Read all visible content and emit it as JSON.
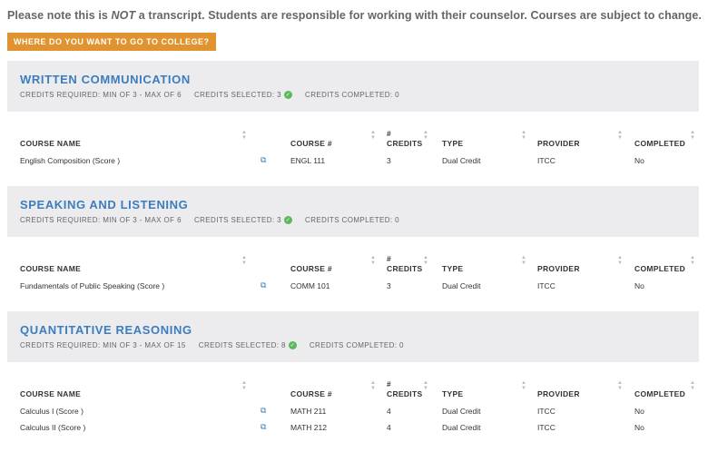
{
  "notice": {
    "prefix": "Please note this is ",
    "emphasis": "NOT",
    "suffix": " a transcript. Students are responsible for working with their counselor. Courses are subject to change."
  },
  "college_button": "WHERE DO YOU WANT TO GO TO COLLEGE?",
  "colors": {
    "accent": "#3c7dbd",
    "button": "#e0932f",
    "check": "#5cb85c",
    "header_bg": "#ececee"
  },
  "columns": {
    "course_name": "COURSE NAME",
    "course_num": "COURSE #",
    "credits_top": "#",
    "credits": "CREDITS",
    "type": "TYPE",
    "provider": "PROVIDER",
    "completed": "COMPLETED"
  },
  "row_icon": "copy-icon",
  "sections": [
    {
      "title": "WRITTEN COMMUNICATION",
      "required": "CREDITS REQUIRED: MIN OF 3 - MAX OF 6",
      "selected": "CREDITS SELECTED: 3",
      "completed": "CREDITS COMPLETED: 0",
      "rows": [
        {
          "name": "English Composition (Score )",
          "num": "ENGL 111",
          "credits": "3",
          "type": "Dual Credit",
          "provider": "ITCC",
          "completed": "No"
        }
      ]
    },
    {
      "title": "SPEAKING AND LISTENING",
      "required": "CREDITS REQUIRED: MIN OF 3 - MAX OF 6",
      "selected": "CREDITS SELECTED: 3",
      "completed": "CREDITS COMPLETED: 0",
      "rows": [
        {
          "name": "Fundamentals of Public Speaking (Score )",
          "num": "COMM 101",
          "credits": "3",
          "type": "Dual Credit",
          "provider": "ITCC",
          "completed": "No"
        }
      ]
    },
    {
      "title": "QUANTITATIVE REASONING",
      "required": "CREDITS REQUIRED: MIN OF 3 - MAX OF 15",
      "selected": "CREDITS SELECTED: 8",
      "completed": "CREDITS COMPLETED: 0",
      "rows": [
        {
          "name": "Calculus I (Score )",
          "num": "MATH 211",
          "credits": "4",
          "type": "Dual Credit",
          "provider": "ITCC",
          "completed": "No"
        },
        {
          "name": "Calculus II (Score )",
          "num": "MATH 212",
          "credits": "4",
          "type": "Dual Credit",
          "provider": "ITCC",
          "completed": "No"
        }
      ]
    }
  ]
}
